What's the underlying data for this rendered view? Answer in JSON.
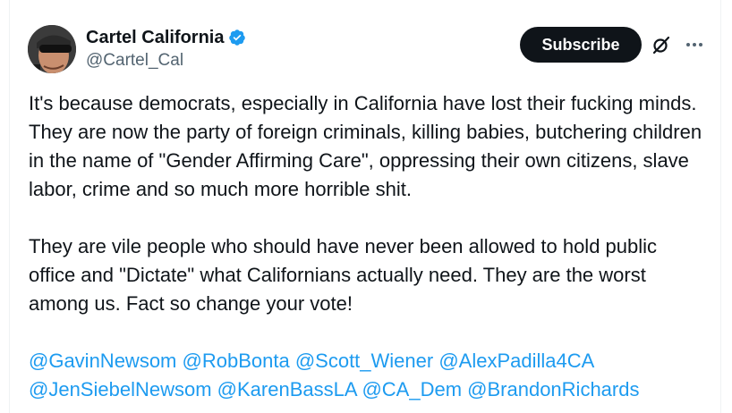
{
  "author": {
    "display_name": "Cartel California",
    "handle": "@Cartel_Cal",
    "verified": true
  },
  "actions": {
    "subscribe_label": "Subscribe",
    "grok_icon": "grok-icon",
    "more_icon": "more-options-icon"
  },
  "tweet": {
    "paragraph_1": "It's because democrats, especially in California have lost their fucking minds. They are now the party of foreign criminals, killing babies, butchering children in the name of \"Gender Affirming Care\", oppressing their own citizens, slave labor, crime and so much more horrible shit.",
    "paragraph_2": "They are vile people who should have never been allowed to hold public office and \"Dictate\" what Californians actually need. They are the worst among us. Fact so change your vote!",
    "mentions": [
      "@GavinNewsom",
      "@RobBonta",
      "@Scott_Wiener",
      "@AlexPadilla4CA",
      "@JenSiebelNewsom",
      "@KarenBassLA",
      "@CA_Dem",
      "@BrandonRichards"
    ]
  },
  "colors": {
    "accent": "#1d9bf0",
    "text": "#0f1419",
    "secondary": "#536471",
    "button_bg": "#0f1419"
  }
}
